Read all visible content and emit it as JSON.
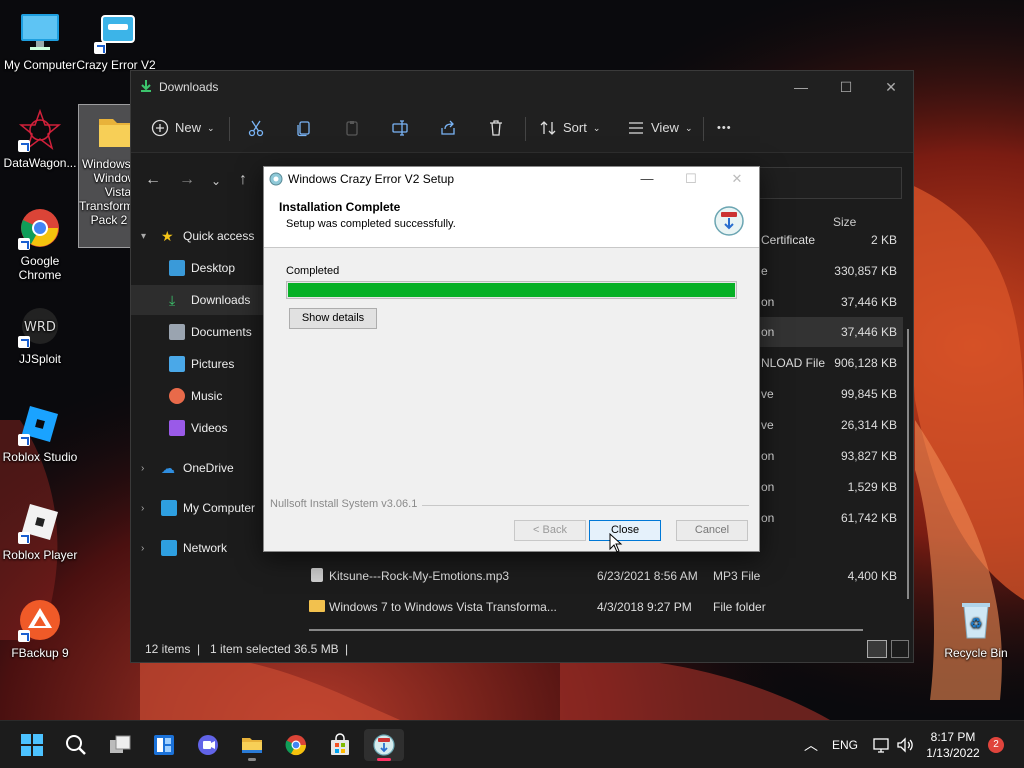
{
  "desktop": {
    "icons": [
      {
        "label": "My Computer"
      },
      {
        "label": "Crazy Error V2"
      },
      {
        "label": "DataWagon..."
      },
      {
        "label": "Windows 7 to Windows Vista Transformation Pack 2 (1)"
      },
      {
        "label": "Google Chrome"
      },
      {
        "label": "JJSploit"
      },
      {
        "label": "Roblox Studio"
      },
      {
        "label": "Roblox Player"
      },
      {
        "label": "FBackup 9"
      },
      {
        "label": "Recycle Bin"
      }
    ]
  },
  "explorer": {
    "title": "Downloads",
    "toolbar": {
      "new_label": "New",
      "sort_label": "Sort",
      "view_label": "View",
      "more_label": "•••"
    },
    "sidebar": {
      "items": [
        {
          "label": "Quick access"
        },
        {
          "label": "Desktop"
        },
        {
          "label": "Downloads"
        },
        {
          "label": "Documents"
        },
        {
          "label": "Pictures"
        },
        {
          "label": "Music"
        },
        {
          "label": "Videos"
        },
        {
          "label": "OneDrive"
        },
        {
          "label": "My Computer"
        },
        {
          "label": "Network"
        }
      ]
    },
    "columns": {
      "size": "Size"
    },
    "rows": [
      {
        "type": "Certificate",
        "size": "2 KB"
      },
      {
        "type": "e",
        "size": "330,857 KB"
      },
      {
        "type": "on",
        "size": "37,446 KB"
      },
      {
        "type": "on",
        "size": "37,446 KB"
      },
      {
        "type": "NLOAD File",
        "size": "906,128 KB"
      },
      {
        "type": "ve",
        "size": "99,845 KB"
      },
      {
        "type": "ve",
        "size": "26,314 KB"
      },
      {
        "type": "on",
        "size": "93,827 KB"
      },
      {
        "type": "on",
        "size": "1,529 KB"
      },
      {
        "type": "on",
        "size": "61,742 KB"
      }
    ],
    "visible_rows": [
      {
        "name": "Kitsune---Rock-My-Emotions.mp3",
        "date": "6/23/2021 8:56 AM",
        "type": "MP3 File",
        "size": "4,400 KB"
      },
      {
        "name": "Windows 7 to Windows Vista Transforma...",
        "date": "4/3/2018 9:27 PM",
        "type": "File folder",
        "size": ""
      }
    ],
    "status": {
      "items": "12 items",
      "selected": "1 item selected",
      "sel_size": "36.5 MB"
    }
  },
  "setup": {
    "title": "Windows Crazy Error V2 Setup",
    "heading": "Installation Complete",
    "subheading": "Setup was completed successfully.",
    "progress_label": "Completed",
    "progress": 1.0,
    "show_details": "Show details",
    "branding": "Nullsoft Install System v3.06.1",
    "back": "< Back",
    "close": "Close",
    "cancel": "Cancel",
    "accent": "#06b025"
  },
  "taskbar": {
    "lang": "ENG",
    "time": "8:17 PM",
    "date": "1/13/2022",
    "notifications": "2"
  }
}
